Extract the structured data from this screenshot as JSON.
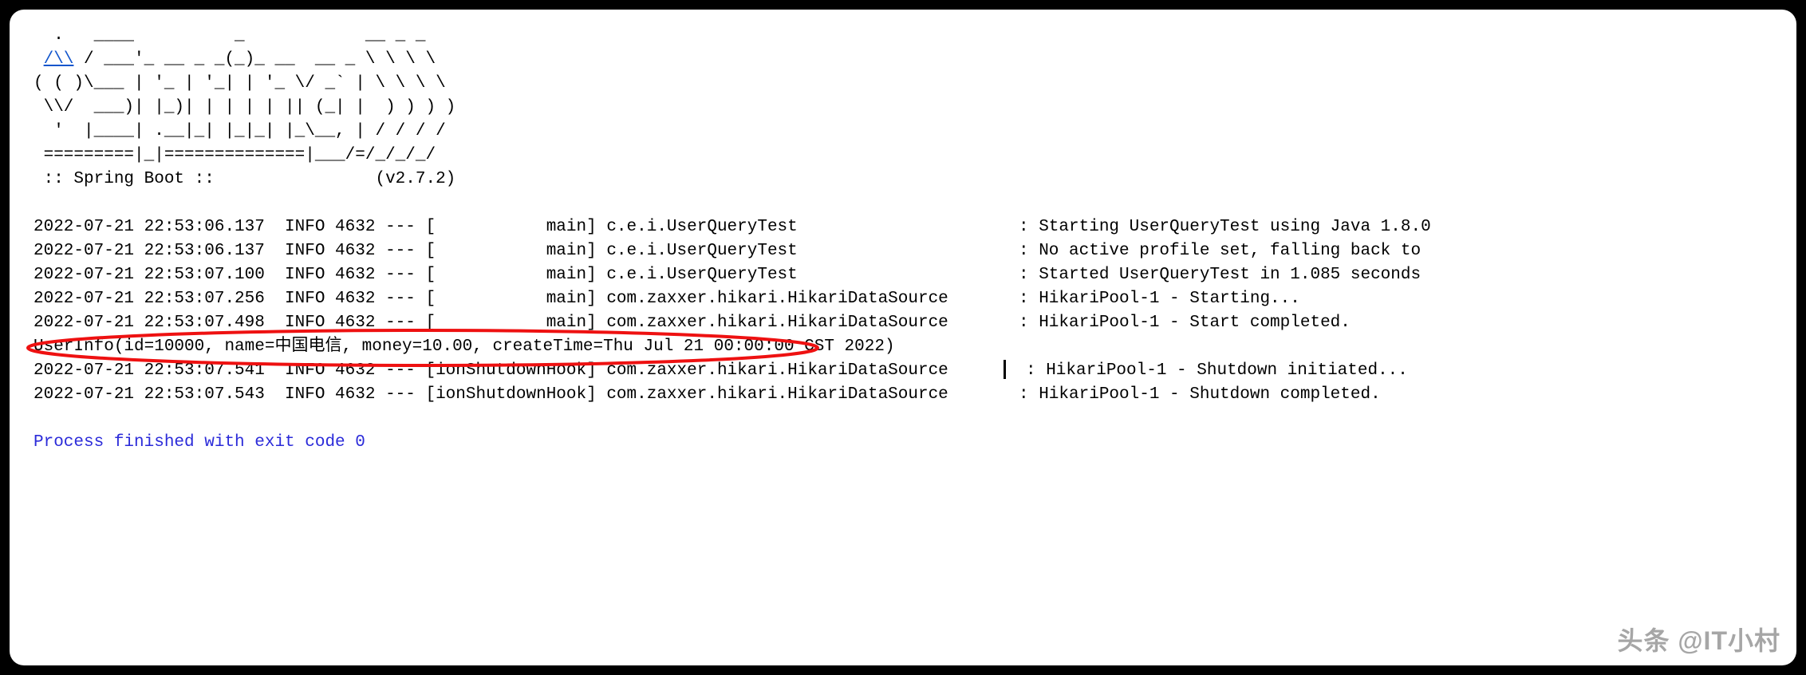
{
  "banner": {
    "l1": "  .   ____          _            __ _ _",
    "l2_pre": " ",
    "l2_link": "/\\\\",
    "l2_post": " / ___'_ __ _ _(_)_ __  __ _ \\ \\ \\ \\",
    "l3": "( ( )\\___ | '_ | '_| | '_ \\/ _` | \\ \\ \\ \\",
    "l4": " \\\\/  ___)| |_)| | | | | || (_| |  ) ) ) )",
    "l5": "  '  |____| .__|_| |_|_| |_\\__, | / / / /",
    "l6": " =========|_|==============|___/=/_/_/_/",
    "l7": " :: Spring Boot ::                (v2.7.2)"
  },
  "logs": {
    "r1": "2022-07-21 22:53:06.137  INFO 4632 --- [           main] c.e.i.UserQueryTest                      : Starting UserQueryTest using Java 1.8.0",
    "r2": "2022-07-21 22:53:06.137  INFO 4632 --- [           main] c.e.i.UserQueryTest                      : No active profile set, falling back to ",
    "r3": "2022-07-21 22:53:07.100  INFO 4632 --- [           main] c.e.i.UserQueryTest                      : Started UserQueryTest in 1.085 seconds ",
    "r4": "2022-07-21 22:53:07.256  INFO 4632 --- [           main] com.zaxxer.hikari.HikariDataSource       : HikariPool-1 - Starting...",
    "r5": "2022-07-21 22:53:07.498  INFO 4632 --- [           main] com.zaxxer.hikari.HikariDataSource       : HikariPool-1 - Start completed.",
    "highlight": "UserInfo(id=10000, name=中国电信, money=10.00, createTime=Thu Jul 21 00:00:00 CST 2022)",
    "r6a": "2022-07-21 22:53:07.541  INFO 4632 --- [ionShutdownHook] com.zaxxer.hikari.HikariDataSource     ",
    "r6b": "  : HikariPool-1 - Shutdown initiated...",
    "r7": "2022-07-21 22:53:07.543  INFO 4632 --- [ionShutdownHook] com.zaxxer.hikari.HikariDataSource       : HikariPool-1 - Shutdown completed."
  },
  "footer": {
    "exit": "Process finished with exit code 0"
  },
  "watermark": "头条 @IT小村"
}
